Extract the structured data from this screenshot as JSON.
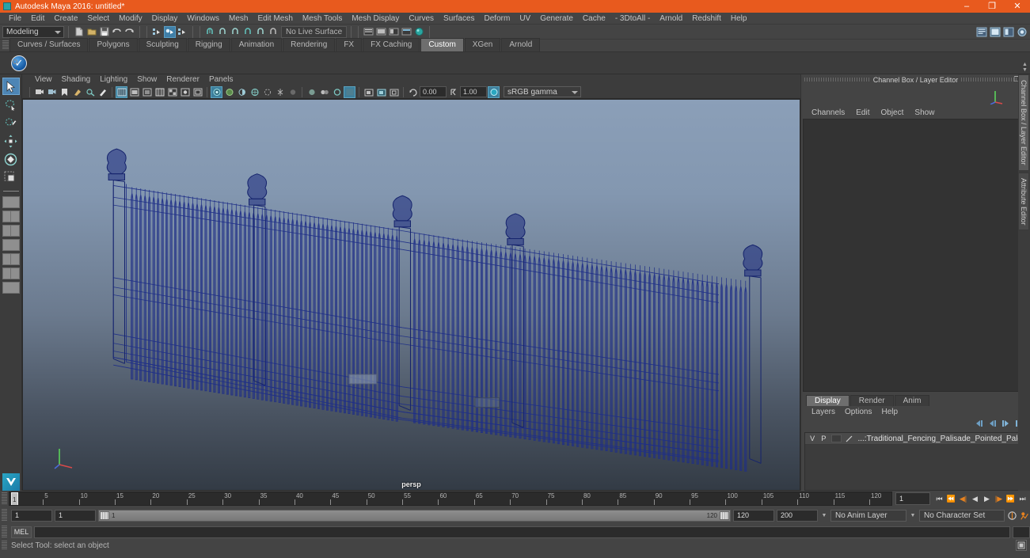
{
  "window": {
    "title": "Autodesk Maya 2016: untitled*",
    "minimize": "–",
    "maximize": "❐",
    "close": "✕"
  },
  "menubar": {
    "items": [
      "File",
      "Edit",
      "Create",
      "Select",
      "Modify",
      "Display",
      "Windows",
      "Mesh",
      "Edit Mesh",
      "Mesh Tools",
      "Mesh Display",
      "Curves",
      "Surfaces",
      "Deform",
      "UV",
      "Generate",
      "Cache",
      "- 3DtoAll -",
      "Arnold",
      "Redshift",
      "Help"
    ]
  },
  "statusbar": {
    "menu_set": "Modeling",
    "live_surface": "No Live Surface"
  },
  "shelf": {
    "tabs": [
      "Curves / Surfaces",
      "Polygons",
      "Sculpting",
      "Rigging",
      "Animation",
      "Rendering",
      "FX",
      "FX Caching",
      "Custom",
      "XGen",
      "Arnold"
    ],
    "active_tab": "Custom",
    "button_glyph": "✓"
  },
  "toolbox": {
    "tools": [
      "select-tool",
      "lasso-tool",
      "paint-select-tool",
      "move-tool",
      "rotate-tool",
      "scale-tool"
    ],
    "active": "select-tool"
  },
  "viewport": {
    "menus": [
      "View",
      "Shading",
      "Lighting",
      "Show",
      "Renderer",
      "Panels"
    ],
    "camera_label": "persp",
    "exposure": "0.00",
    "gamma": "1.00",
    "color_space": "sRGB gamma",
    "bg_top": "#8b9fb8",
    "bg_bottom": "#333b45",
    "wire_color": "#1f2f87"
  },
  "channel_box": {
    "title": "Channel Box / Layer Editor",
    "menus": [
      "Channels",
      "Edit",
      "Object",
      "Show"
    ],
    "undock_glyph": "❐",
    "close_glyph": "✕"
  },
  "layer_editor": {
    "tabs": [
      "Display",
      "Render",
      "Anim"
    ],
    "active_tab": "Display",
    "menus": [
      "Layers",
      "Options",
      "Help"
    ],
    "rows": [
      {
        "visible": "V",
        "playback": "P",
        "name": "...:Traditional_Fencing_Palisade_Pointed_Pales"
      }
    ]
  },
  "vertical_tabs": {
    "items": [
      "Channel Box / Layer Editor",
      "Attribute Editor"
    ],
    "active": "Channel Box / Layer Editor"
  },
  "timeline": {
    "ticks": [
      {
        "label": "1",
        "frame": 1
      },
      {
        "label": "5",
        "frame": 5
      },
      {
        "label": "10",
        "frame": 10
      },
      {
        "label": "15",
        "frame": 15
      },
      {
        "label": "20",
        "frame": 20
      },
      {
        "label": "25",
        "frame": 25
      },
      {
        "label": "30",
        "frame": 30
      },
      {
        "label": "35",
        "frame": 35
      },
      {
        "label": "40",
        "frame": 40
      },
      {
        "label": "45",
        "frame": 45
      },
      {
        "label": "50",
        "frame": 50
      },
      {
        "label": "55",
        "frame": 55
      },
      {
        "label": "60",
        "frame": 60
      },
      {
        "label": "65",
        "frame": 65
      },
      {
        "label": "70",
        "frame": 70
      },
      {
        "label": "75",
        "frame": 75
      },
      {
        "label": "80",
        "frame": 80
      },
      {
        "label": "85",
        "frame": 85
      },
      {
        "label": "90",
        "frame": 90
      },
      {
        "label": "95",
        "frame": 95
      },
      {
        "label": "100",
        "frame": 100
      },
      {
        "label": "105",
        "frame": 105
      },
      {
        "label": "110",
        "frame": 110
      },
      {
        "label": "115",
        "frame": 115
      },
      {
        "label": "120",
        "frame": 120
      }
    ],
    "current_frame": "1",
    "current_frame_field": "1",
    "start": 1,
    "end": 120
  },
  "range_slider": {
    "anim_start": "1",
    "range_start": "1",
    "bar_start_label": "1",
    "bar_end_label": "120",
    "range_end": "120",
    "anim_end": "200",
    "anim_layer": "No Anim Layer",
    "character_set": "No Character Set"
  },
  "command_line": {
    "language": "MEL",
    "input_value": "",
    "input_placeholder": ""
  },
  "help_line": {
    "text": "Select Tool: select an object"
  }
}
